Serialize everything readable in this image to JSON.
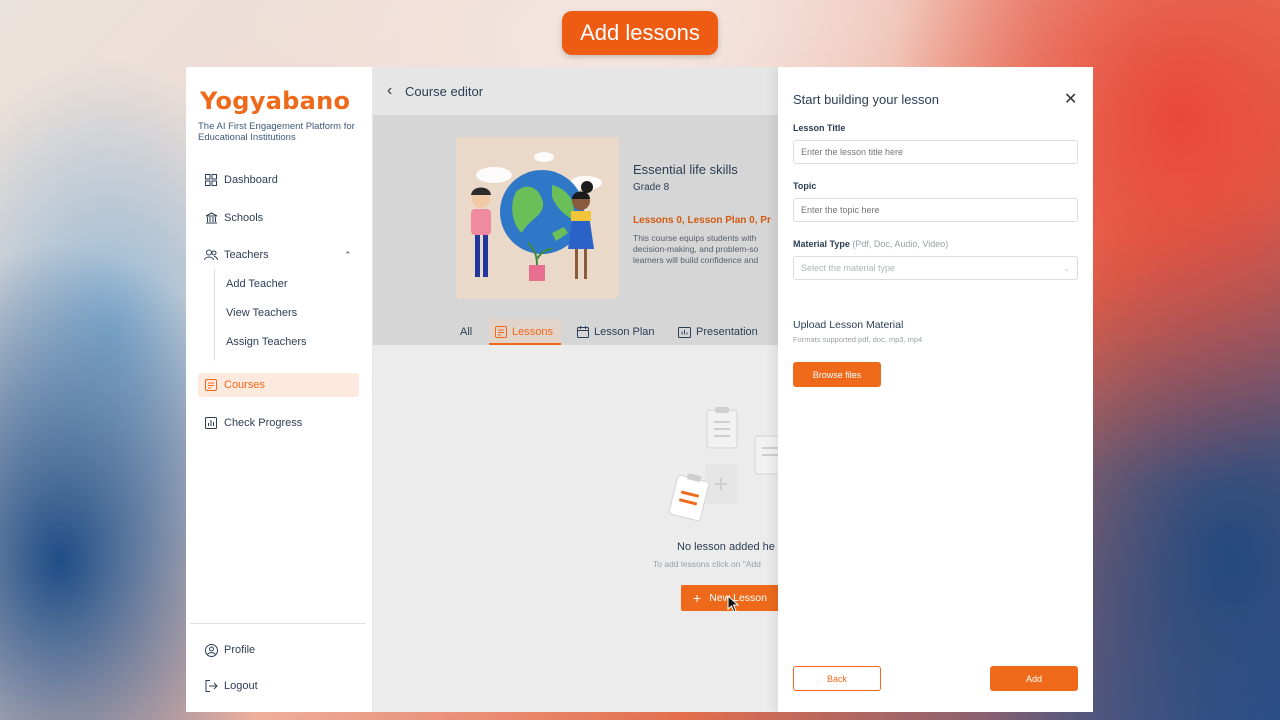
{
  "banner": {
    "label": "Add lessons"
  },
  "sidebar": {
    "logo": "Yogyabano",
    "tagline": "The AI First Engagement Platform for Educational Institutions",
    "items": [
      {
        "label": "Dashboard",
        "icon": "grid-icon"
      },
      {
        "label": "Schools",
        "icon": "building-icon"
      },
      {
        "label": "Teachers",
        "icon": "users-icon"
      },
      {
        "label": "Courses",
        "icon": "book-icon"
      },
      {
        "label": "Check Progress",
        "icon": "chart-icon"
      }
    ],
    "teacher_sub": [
      "Add Teacher",
      "View Teachers",
      "Assign Teachers"
    ],
    "footer": [
      {
        "label": "Profile",
        "icon": "user-circle-icon"
      },
      {
        "label": "Logout",
        "icon": "logout-icon"
      }
    ],
    "active": "Courses"
  },
  "main": {
    "title": "Course editor",
    "course": {
      "title": "Essential life skills",
      "grade": "Grade 8",
      "stats": "Lessons 0, Lesson Plan 0, Pr",
      "description": [
        "This course equips students with",
        "decision-making, and problem-so",
        "learners will build confidence and"
      ]
    },
    "tabs": [
      "All",
      "Lessons",
      "Lesson Plan",
      "Presentation"
    ],
    "active_tab": "Lessons",
    "empty": {
      "title": "No lesson added he",
      "subtitle": "To add lessons click on \"Add",
      "button": "New Lesson"
    }
  },
  "drawer": {
    "title": "Start building your lesson",
    "lesson_title_label": "Lesson Title",
    "lesson_title_placeholder": "Enter the lesson title here",
    "topic_label": "Topic",
    "topic_placeholder": "Enter the topic here",
    "material_label": "Material Type",
    "material_hint": "(Pdf, Doc, Audio, Video)",
    "material_placeholder": "Select the material type",
    "upload_title": "Upload Lesson Material",
    "upload_sub": "Formats supported pdf, doc, mp3, mp4",
    "browse": "Browse files",
    "back": "Back",
    "add": "Add"
  },
  "colors": {
    "accent": "#ee6a1a",
    "text": "#2c3e55"
  }
}
